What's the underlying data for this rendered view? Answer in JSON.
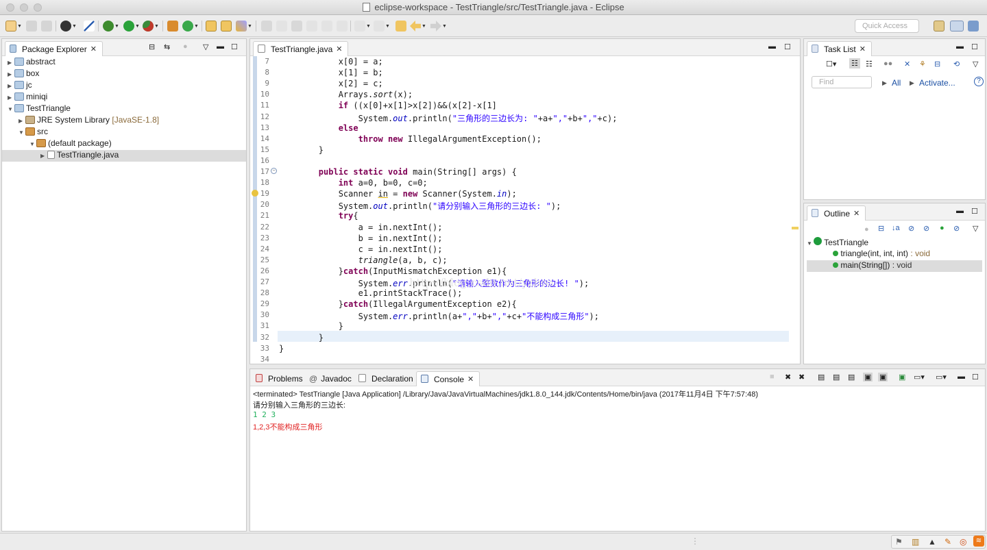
{
  "window": {
    "title": "eclipse-workspace - TestTriangle/src/TestTriangle.java - Eclipse"
  },
  "toolbar": {
    "quick_access_placeholder": "Quick Access"
  },
  "package_explorer": {
    "tab_label": "Package Explorer",
    "items": [
      {
        "label": "abstract",
        "suffix": ""
      },
      {
        "label": "box",
        "suffix": ""
      },
      {
        "label": "jc",
        "suffix": ""
      },
      {
        "label": "miniqi",
        "suffix": ""
      },
      {
        "label": "TestTriangle",
        "suffix": ""
      },
      {
        "label": "JRE System Library",
        "suffix": "[JavaSE-1.8]"
      },
      {
        "label": "src",
        "suffix": ""
      },
      {
        "label": "(default package)",
        "suffix": ""
      },
      {
        "label": "TestTriangle.java",
        "suffix": ""
      }
    ]
  },
  "editor": {
    "tab_label": "TestTriangle.java",
    "line_numbers": [
      "7",
      "8",
      "9",
      "10",
      "11",
      "12",
      "13",
      "14",
      "15",
      "16",
      "17",
      "18",
      "19",
      "20",
      "21",
      "22",
      "23",
      "24",
      "25",
      "26",
      "27",
      "28",
      "29",
      "30",
      "31",
      "32",
      "33",
      "34"
    ],
    "watermark": "http://blog.csdn.net/yzboa"
  },
  "task_list": {
    "tab_label": "Task List",
    "find_placeholder": "Find",
    "all_label": "All",
    "activate_label": "Activate..."
  },
  "outline": {
    "tab_label": "Outline",
    "class_name": "TestTriangle",
    "members": [
      {
        "label": "triangle(int, int, int)",
        "type": " : void"
      },
      {
        "label": "main(String[])",
        "type": " : void"
      }
    ]
  },
  "bottom_tabs": {
    "problems": "Problems",
    "javadoc": "Javadoc",
    "declaration": "Declaration",
    "console": "Console"
  },
  "console": {
    "header": "<terminated> TestTriangle [Java Application] /Library/Java/JavaVirtualMachines/jdk1.8.0_144.jdk/Contents/Home/bin/java (2017年11月4日 下午7:57:48)",
    "prompt_line": "请分别输入三角形的三边长:",
    "input_line": "1 2 3",
    "error_line": "1,2,3不能构成三角形"
  },
  "colors": {
    "keyword": "#7f0055",
    "string": "#2a00ff",
    "field": "#0000c0",
    "console_input": "#1faf5b",
    "console_error": "#e02020"
  }
}
